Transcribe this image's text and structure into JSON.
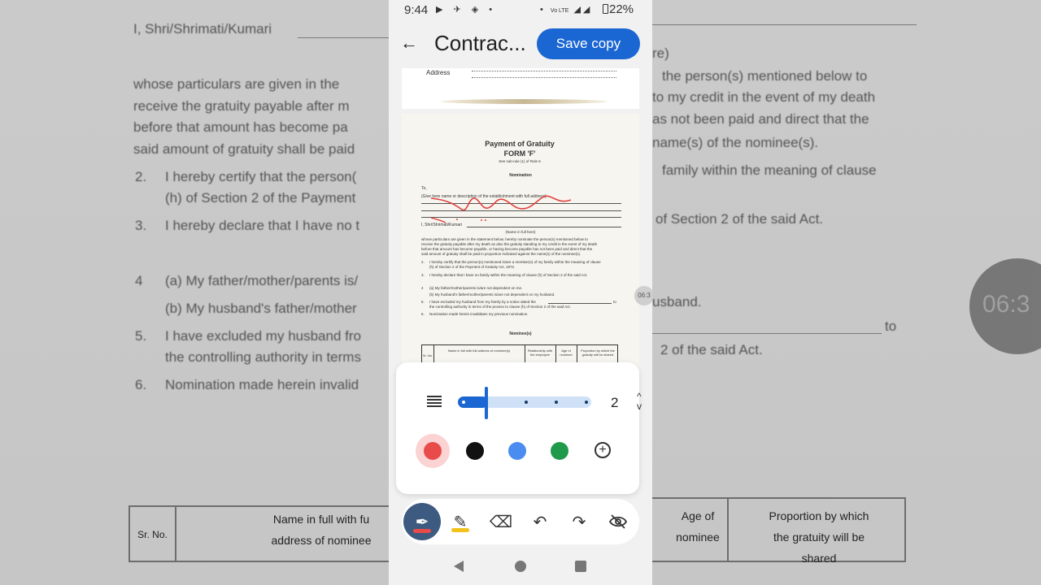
{
  "status_bar": {
    "time": "9:44",
    "battery": "22%",
    "network": "Vo LTE"
  },
  "app_bar": {
    "title": "Contrac...",
    "save_label": "Save copy"
  },
  "document": {
    "page1_label": "Address",
    "page2": {
      "title": "Payment of Gratuity",
      "form": "FORM 'F'",
      "rule": "See sub-rule (1) of Rule 6",
      "heading": "Nomination",
      "to": "To,",
      "give_here": "(Give here name or description of the establishment with full address)",
      "shri": "I, Shri/Shrimati/Kumari",
      "name_full": "(Name in full here)",
      "para1": "whose particulars are given in the statement below, hereby nominate the person(s) mentioned below to",
      "para2": "receive the gratuity payable after my death as also the gratuity standing to my credit in the event of my death",
      "para3": "before that amount has become payable, or having become payable has not been paid and direct that the",
      "para4": "said amount of gratuity shall be paid in proportion indicated against the name(s) of the nominee(s).",
      "item2a": "I hereby certify that the person(s) mentioned is/are a member(s) of my family within the meaning of clause",
      "item2b": "(h) of Section 2 of the Payment of Gratuity Act, 1972.",
      "item3": "I hereby declare that I have no family within the meaning of clause (h) of Section 2 of the said Act.",
      "item4a": "(a) My father/mother/parents is/are not dependent on me.",
      "item4b": "(b) My husband's father/mother/parents is/are not dependent on my husband.",
      "item5a": "I have excluded my husband from my family by a notice dated the",
      "item5b": "the controlling authority in terms of the proviso to clause (h) of Section 2 of the said Act.",
      "item6": "Nomination made herein invalidates my previous nomination.",
      "nominees": "Nominee(s)",
      "table_headers": [
        "Sr. No.",
        "Name in full with full address of nominee(s)",
        "Relationship with the employee",
        "Age of nominee",
        "Proportion by which the gratuity will be shared"
      ]
    }
  },
  "pen_panel": {
    "size_value": "2",
    "size_fraction": 0.2,
    "colors": [
      "#e94b4b",
      "#111111",
      "#4a8cf0",
      "#1f9a4a"
    ],
    "selected_color": "#e94b4b"
  },
  "toolbar": {
    "tools": [
      "pen-icon",
      "highlighter-icon",
      "eraser-icon",
      "undo-icon",
      "redo-icon",
      "hide-annotations-icon"
    ],
    "pen_color": "#e94b4b",
    "highlighter_color": "#f2c31a"
  },
  "overlay": {
    "timestamp": "06:3"
  },
  "background": {
    "shri": "I, Shri/Shrimati/Kumari",
    "right_top": "re)",
    "l1": "whose particulars are given in the",
    "l2": "receive the gratuity payable after m",
    "l3": "before that amount has become pa",
    "l4": "said amount of gratuity shall be paid",
    "r1": "the person(s) mentioned below to",
    "r2": "to my credit in the event of my death",
    "r3": "as not been paid and direct that the",
    "r4": "name(s) of the nominee(s).",
    "n2": "2.",
    "i2": "I hereby certify that the person(",
    "i2b": "(h) of Section 2 of the Payment",
    "r5": "family within the meaning of clause",
    "n3": "3.",
    "i3": "I hereby declare that I have no t",
    "r6": "of Section 2 of the said Act.",
    "n4": "4",
    "i4": "(a) My father/mother/parents is/",
    "i4b": "(b) My husband's father/mother",
    "r7": "usband.",
    "n5": "5.",
    "i5": "I have excluded my husband fro",
    "i5b": "the controlling authority in terms",
    "r8": "to",
    "r9": "2 of the said Act.",
    "n6": "6.",
    "i6": "Nomination made herein invalid",
    "th1": "Sr. No.",
    "th2a": "Name in full with fu",
    "th2b": "address of nominee",
    "th3a": "Age of",
    "th3b": "nominee",
    "th4a": "Proportion by which",
    "th4b": "the gratuity will be",
    "th4c": "shared",
    "circle": "06:3"
  }
}
